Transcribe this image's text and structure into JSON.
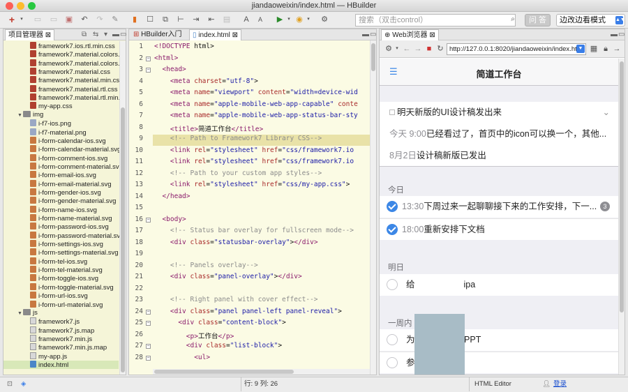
{
  "window": {
    "title": "jiandaoweixin/index.html  —  HBuilder"
  },
  "toolbar": {
    "search_placeholder": "搜索（双击control）",
    "ask_label": "问 答",
    "mode_label": "边改边看模式"
  },
  "project": {
    "tab_label": "项目管理器",
    "files": [
      {
        "name": "framework7.ios.rtl.min.css",
        "type": "css",
        "indent": 3
      },
      {
        "name": "framework7.material.colors.cs",
        "type": "css",
        "indent": 3
      },
      {
        "name": "framework7.material.colors.mi",
        "type": "css",
        "indent": 3
      },
      {
        "name": "framework7.material.css",
        "type": "css",
        "indent": 3
      },
      {
        "name": "framework7.material.min.css",
        "type": "css",
        "indent": 3
      },
      {
        "name": "framework7.material.rtl.css",
        "type": "css",
        "indent": 3
      },
      {
        "name": "framework7.material.rtl.min.css",
        "type": "css",
        "indent": 3
      },
      {
        "name": "my-app.css",
        "type": "css",
        "indent": 3
      },
      {
        "name": "img",
        "type": "folder",
        "indent": 2
      },
      {
        "name": "i-f7-ios.png",
        "type": "png",
        "indent": 3
      },
      {
        "name": "i-f7-material.png",
        "type": "png",
        "indent": 3
      },
      {
        "name": "i-form-calendar-ios.svg",
        "type": "svg",
        "indent": 3
      },
      {
        "name": "i-form-calendar-material.svg",
        "type": "svg",
        "indent": 3
      },
      {
        "name": "i-form-comment-ios.svg",
        "type": "svg",
        "indent": 3
      },
      {
        "name": "i-form-comment-material.svg",
        "type": "svg",
        "indent": 3
      },
      {
        "name": "i-form-email-ios.svg",
        "type": "svg",
        "indent": 3
      },
      {
        "name": "i-form-email-material.svg",
        "type": "svg",
        "indent": 3
      },
      {
        "name": "i-form-gender-ios.svg",
        "type": "svg",
        "indent": 3
      },
      {
        "name": "i-form-gender-material.svg",
        "type": "svg",
        "indent": 3
      },
      {
        "name": "i-form-name-ios.svg",
        "type": "svg",
        "indent": 3
      },
      {
        "name": "i-form-name-material.svg",
        "type": "svg",
        "indent": 3
      },
      {
        "name": "i-form-password-ios.svg",
        "type": "svg",
        "indent": 3
      },
      {
        "name": "i-form-password-material.svg",
        "type": "svg",
        "indent": 3
      },
      {
        "name": "i-form-settings-ios.svg",
        "type": "svg",
        "indent": 3
      },
      {
        "name": "i-form-settings-material.svg",
        "type": "svg",
        "indent": 3
      },
      {
        "name": "i-form-tel-ios.svg",
        "type": "svg",
        "indent": 3
      },
      {
        "name": "i-form-tel-material.svg",
        "type": "svg",
        "indent": 3
      },
      {
        "name": "i-form-toggle-ios.svg",
        "type": "svg",
        "indent": 3
      },
      {
        "name": "i-form-toggle-material.svg",
        "type": "svg",
        "indent": 3
      },
      {
        "name": "i-form-url-ios.svg",
        "type": "svg",
        "indent": 3
      },
      {
        "name": "i-form-url-material.svg",
        "type": "svg",
        "indent": 3
      },
      {
        "name": "js",
        "type": "folder",
        "indent": 2
      },
      {
        "name": "framework7.js",
        "type": "js",
        "indent": 3
      },
      {
        "name": "framework7.js.map",
        "type": "js",
        "indent": 3
      },
      {
        "name": "framework7.min.js",
        "type": "js",
        "indent": 3
      },
      {
        "name": "framework7.min.js.map",
        "type": "js",
        "indent": 3
      },
      {
        "name": "my-app.js",
        "type": "js",
        "indent": 3
      },
      {
        "name": "index.html",
        "type": "html",
        "indent": 2
      }
    ]
  },
  "editor": {
    "tabs": [
      "HBuilder入门",
      "index.html"
    ],
    "lines": [
      {
        "n": "1",
        "fold": "",
        "html": "<span class='kw'>&lt;!DOCTYPE</span> html&gt;"
      },
      {
        "n": "2",
        "fold": "-",
        "html": "<span class='kw'>&lt;html&gt;</span>"
      },
      {
        "n": "3",
        "fold": "-",
        "html": "  <span class='kw'>&lt;head&gt;</span>"
      },
      {
        "n": "4",
        "fold": "",
        "html": "    <span class='kw'>&lt;meta</span> <span class='at'>charset</span>=<span class='st'>\"utf-8\"</span>&gt;"
      },
      {
        "n": "5",
        "fold": "",
        "html": "    <span class='kw'>&lt;meta</span> <span class='at'>name</span>=<span class='st'>\"viewport\"</span> <span class='at'>content</span>=<span class='st'>\"width=device-wid</span>"
      },
      {
        "n": "6",
        "fold": "",
        "html": "    <span class='kw'>&lt;meta</span> <span class='at'>name</span>=<span class='st'>\"apple-mobile-web-app-capable\"</span> <span class='at'>conte</span>"
      },
      {
        "n": "7",
        "fold": "",
        "html": "    <span class='kw'>&lt;meta</span> <span class='at'>name</span>=<span class='st'>\"apple-mobile-web-app-status-bar-sty</span>"
      },
      {
        "n": "8",
        "fold": "",
        "html": "    <span class='kw'>&lt;title&gt;</span>简道工作台<span class='kw'>&lt;/title&gt;</span>"
      },
      {
        "n": "9",
        "fold": "",
        "html": "    <span class='cm'>&lt;!-- Path to Framework7 Library CSS--&gt;</span>"
      },
      {
        "n": "10",
        "fold": "",
        "html": "    <span class='kw'>&lt;link</span> <span class='at'>rel</span>=<span class='st'>\"stylesheet\"</span> <span class='at'>href</span>=<span class='st'>\"css/framework7.io</span>"
      },
      {
        "n": "11",
        "fold": "",
        "html": "    <span class='kw'>&lt;link</span> <span class='at'>rel</span>=<span class='st'>\"stylesheet\"</span> <span class='at'>href</span>=<span class='st'>\"css/framework7.io</span>"
      },
      {
        "n": "12",
        "fold": "",
        "html": "    <span class='cm'>&lt;!-- Path to your custom app styles--&gt;</span>"
      },
      {
        "n": "13",
        "fold": "",
        "html": "    <span class='kw'>&lt;link</span> <span class='at'>rel</span>=<span class='st'>\"stylesheet\"</span> <span class='at'>href</span>=<span class='st'>\"css/my-app.css\"</span>&gt;"
      },
      {
        "n": "14",
        "fold": "",
        "html": "  <span class='kw'>&lt;/head&gt;</span>"
      },
      {
        "n": "15",
        "fold": "",
        "html": ""
      },
      {
        "n": "16",
        "fold": "-",
        "html": "  <span class='kw'>&lt;body&gt;</span>"
      },
      {
        "n": "17",
        "fold": "",
        "html": "    <span class='cm'>&lt;!-- Status bar overlay for fullscreen mode--&gt;</span>"
      },
      {
        "n": "18",
        "fold": "",
        "html": "    <span class='kw'>&lt;div</span> <span class='at'>class</span>=<span class='st'>\"statusbar-overlay\"</span>&gt;<span class='kw'>&lt;/div&gt;</span>"
      },
      {
        "n": "19",
        "fold": "",
        "html": ""
      },
      {
        "n": "20",
        "fold": "",
        "html": "    <span class='cm'>&lt;!-- Panels overlay--&gt;</span>"
      },
      {
        "n": "21",
        "fold": "",
        "html": "    <span class='kw'>&lt;div</span> <span class='at'>class</span>=<span class='st'>\"panel-overlay\"</span>&gt;<span class='kw'>&lt;/div&gt;</span>"
      },
      {
        "n": "22",
        "fold": "",
        "html": ""
      },
      {
        "n": "23",
        "fold": "",
        "html": "    <span class='cm'>&lt;!-- Right panel with cover effect--&gt;</span>"
      },
      {
        "n": "24",
        "fold": "-",
        "html": "    <span class='kw'>&lt;div</span> <span class='at'>class</span>=<span class='st'>\"panel panel-left panel-reveal\"</span>&gt;"
      },
      {
        "n": "25",
        "fold": "-",
        "html": "      <span class='kw'>&lt;div</span> <span class='at'>class</span>=<span class='st'>\"content-block\"</span>&gt;"
      },
      {
        "n": "26",
        "fold": "",
        "html": "        <span class='kw'>&lt;p&gt;</span>工作台<span class='kw'>&lt;/p&gt;</span>"
      },
      {
        "n": "27",
        "fold": "-",
        "html": "        <span class='kw'>&lt;div</span> <span class='at'>class</span>=<span class='st'>\"list-block\"</span>&gt;"
      },
      {
        "n": "28",
        "fold": "-",
        "html": "          <span class='kw'>&lt;ul&gt;</span>"
      }
    ]
  },
  "browser": {
    "tab_label": "Web浏览器",
    "url": "http://127.0.0.1:8020/jiandaoweixin/index.html",
    "app_title": "简道工作台",
    "items_top": [
      {
        "text": "明天新版的UI设计稿发出来"
      },
      {
        "time": "今天 9:00",
        "text": "已经看过了，首页中的icon可以换一个，其他..."
      },
      {
        "time": "8月2日",
        "text": "设计稿新版已发出"
      }
    ],
    "section_today": "今日",
    "today_items": [
      {
        "time": "13:30",
        "text": "下周过来一起聊聊接下来的工作安排，下一...",
        "badge": "3"
      },
      {
        "time": "18:00",
        "text": "重新安排下文档"
      }
    ],
    "section_tomorrow": "明日",
    "tomorrow_items": [
      {
        "text": "给",
        "text2": "ipa"
      }
    ],
    "section_week": "一周内",
    "week_items": [
      {
        "text": "为",
        "text2": "备PPT"
      },
      {
        "text": "参",
        "text2": ""
      }
    ]
  },
  "status": {
    "position": "行: 9 列: 26",
    "editor_type": "HTML Editor",
    "login": "登录"
  },
  "colors": {
    "accent": "#3c87e6",
    "editor_bg": "#fbfbe4",
    "tree_bg": "#f5f5d8",
    "redacted": "#a8bcc6"
  }
}
